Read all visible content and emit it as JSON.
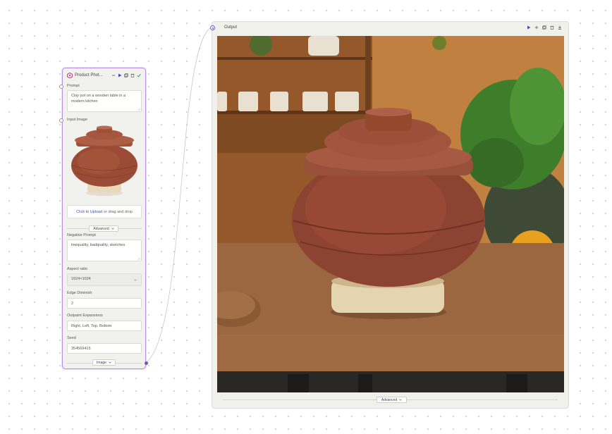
{
  "node": {
    "title": "Product Phot...",
    "prompt_label": "Prompt",
    "prompt_value": "Clay pot on a wooden table in a modern kitchen",
    "input_image_label": "Input Image",
    "upload_link": "Click to Upload",
    "upload_text": "or drag and drop",
    "advanced_label": "Advanced",
    "negative_prompt_label": "Negative Prompt",
    "negative_prompt_value": "lowquality, badquality, sketches",
    "aspect_ratio_label": "Aspect ratio",
    "aspect_ratio_value": "1024×1024",
    "edge_diminish_label": "Edge Diminish",
    "edge_diminish_value": "2",
    "outpaint_label": "Outpaint Expansions",
    "outpaint_value": "Right, Left, Top, Bottom",
    "seed_label": "Seed",
    "seed_value": "354569415",
    "output_type_label": "Image"
  },
  "output_panel": {
    "title": "Output",
    "advanced_label": "Advanced"
  },
  "icons": {
    "node_logo": "hexagon-logo-icon",
    "node_actions": [
      "minimize-icon",
      "play-icon",
      "duplicate-icon",
      "delete-icon",
      "check-icon"
    ],
    "panel_actions": [
      "play-icon",
      "add-icon",
      "copy-icon",
      "delete-icon",
      "download-icon"
    ]
  },
  "colors": {
    "accent": "#6c56c9",
    "node_border": "#b98ee6",
    "link": "#3b4fbf",
    "success": "#2e9b4d"
  }
}
